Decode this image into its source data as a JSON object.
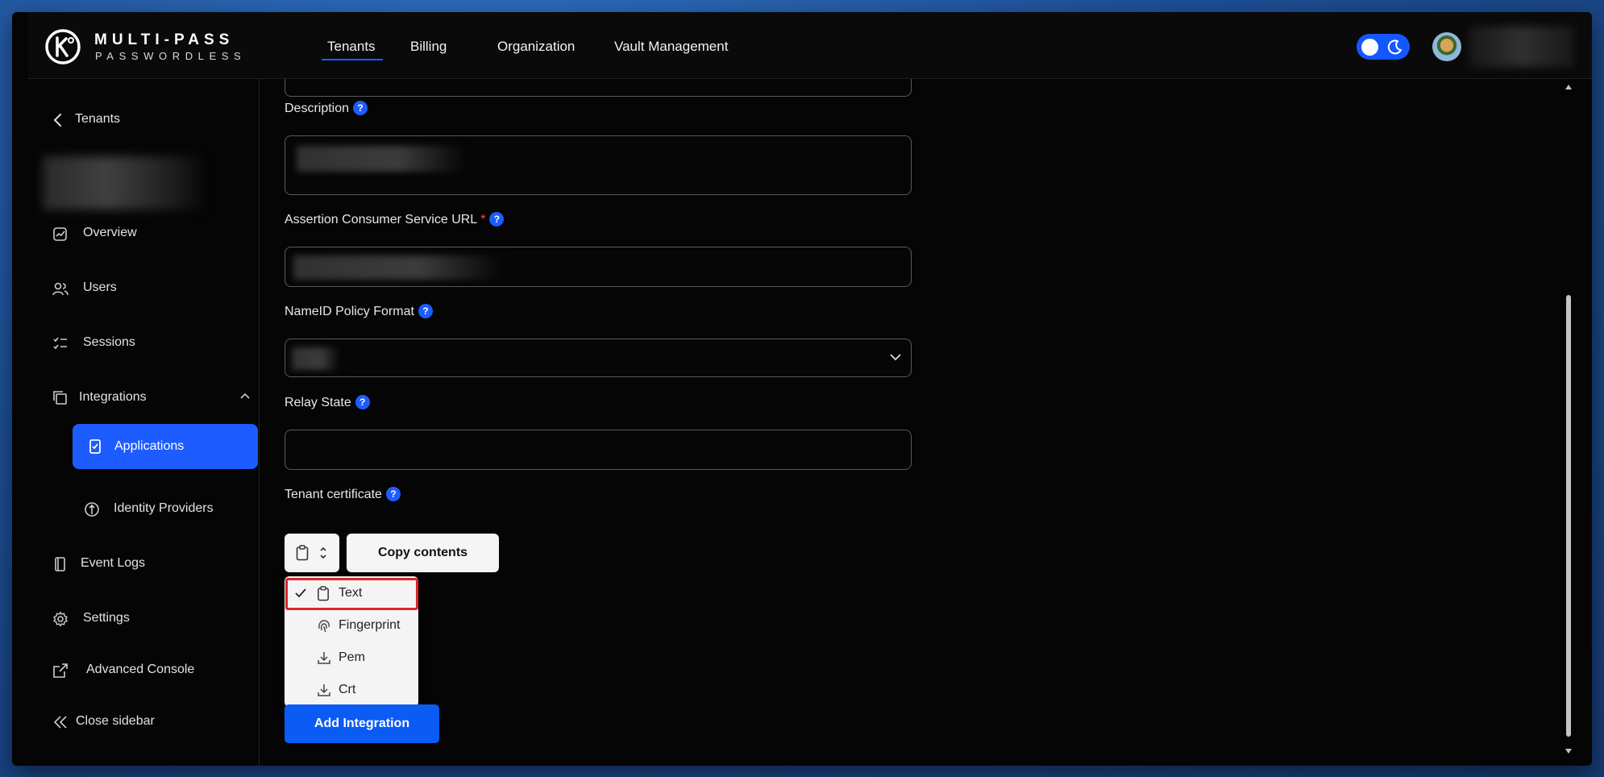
{
  "brand": {
    "title": "MULTI-PASS",
    "subtitle": "PASSWORDLESS",
    "logo_letter": "K"
  },
  "topnav": {
    "items": [
      {
        "label": "Tenants",
        "active": true
      },
      {
        "label": "Billing"
      },
      {
        "label": "Organization"
      },
      {
        "label": "Vault Management"
      }
    ],
    "theme_toggle": {
      "state": "dark",
      "icons": [
        "sun-knob-icon",
        "moon-icon"
      ]
    },
    "accent_color": "#1d5cff"
  },
  "sidebar": {
    "back_label": "Tenants",
    "items": [
      {
        "label": "Overview",
        "icon": "chart-icon"
      },
      {
        "label": "Users",
        "icon": "users-icon"
      },
      {
        "label": "Sessions",
        "icon": "checklist-icon"
      },
      {
        "label": "Integrations",
        "icon": "integrations-icon",
        "expanded": true
      },
      {
        "label": "Applications",
        "icon": "app-icon",
        "active": true
      },
      {
        "label": "Identity Providers",
        "icon": "identity-icon"
      },
      {
        "label": "Event Logs",
        "icon": "log-icon"
      },
      {
        "label": "Settings",
        "icon": "gear-icon"
      },
      {
        "label": "Advanced Console",
        "icon": "external-link-icon"
      },
      {
        "label": "Close sidebar",
        "icon": "double-chevron-left-icon"
      }
    ]
  },
  "form": {
    "description": {
      "label": "Description"
    },
    "acs_url": {
      "label": "Assertion Consumer Service URL",
      "required_mark": "*"
    },
    "nameid": {
      "label": "NameID Policy Format"
    },
    "relay_state": {
      "label": "Relay State",
      "value": ""
    },
    "tenant_certificate": {
      "label": "Tenant certificate",
      "copy_button": "Copy contents",
      "dropdown": [
        {
          "label": "Text",
          "icon": "clipboard-icon",
          "selected": true
        },
        {
          "label": "Fingerprint",
          "icon": "fingerprint-icon"
        },
        {
          "label": "Pem",
          "icon": "download-icon"
        },
        {
          "label": "Crt",
          "icon": "download-icon"
        }
      ]
    },
    "submit_label": "Add Integration",
    "help_glyph": "?"
  }
}
